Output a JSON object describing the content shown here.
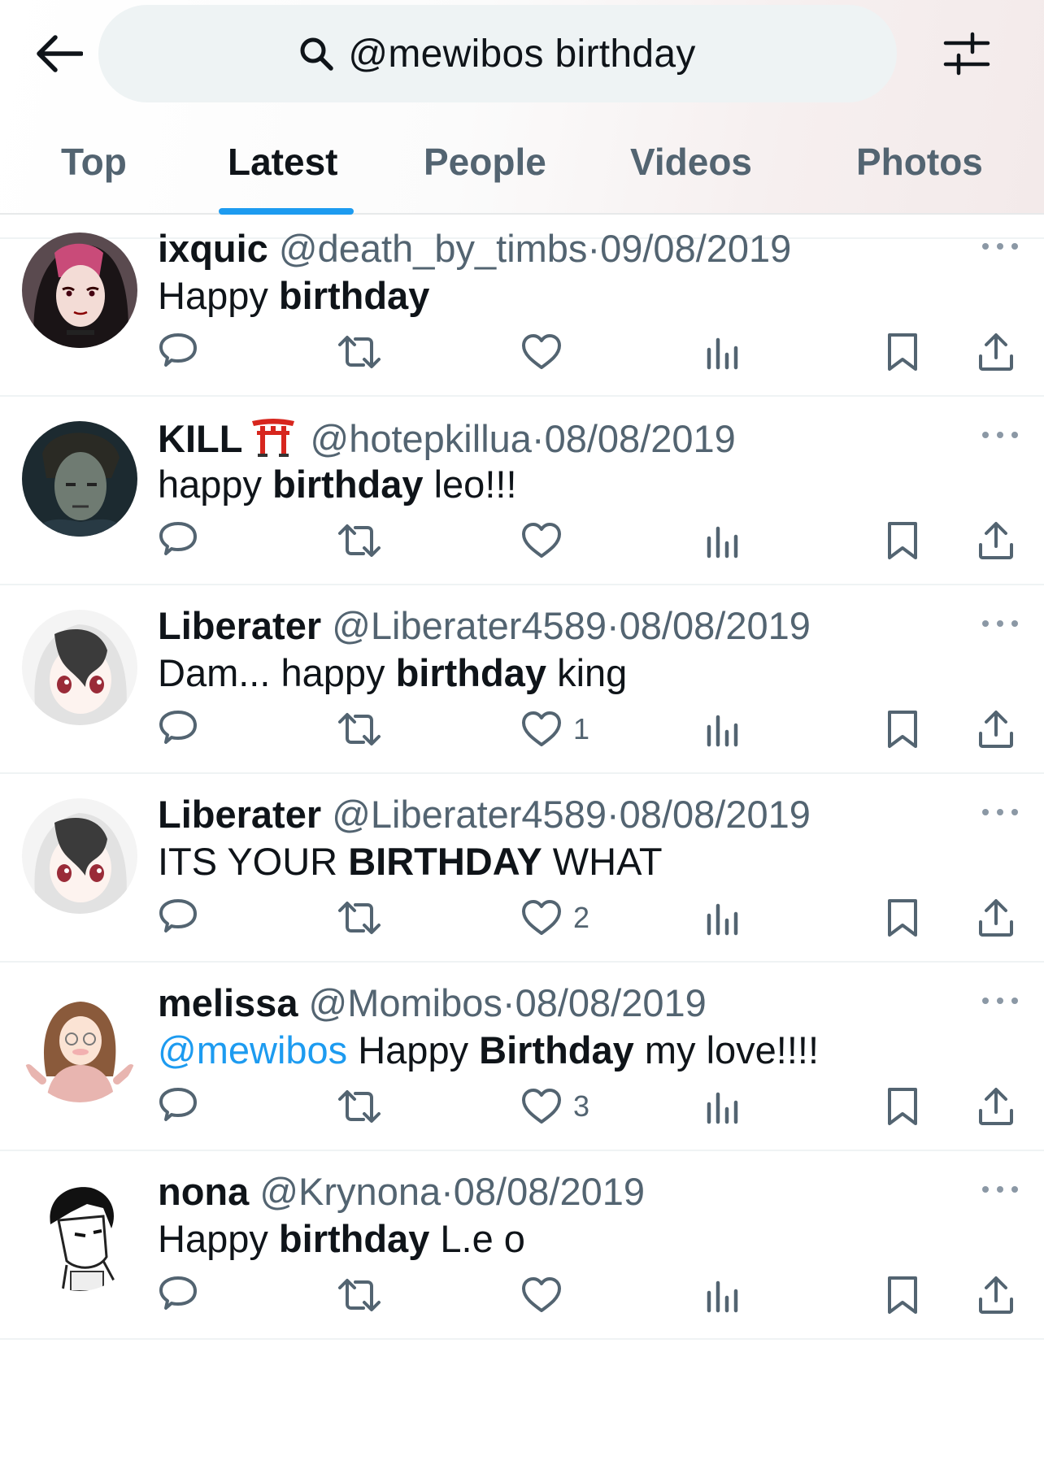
{
  "search": {
    "query": "@mewibos birthday"
  },
  "tabs": [
    {
      "label": "Top"
    },
    {
      "label": "Latest"
    },
    {
      "label": "People"
    },
    {
      "label": "Videos"
    },
    {
      "label": "Photos"
    }
  ],
  "active_tab": "Latest",
  "colors": {
    "accent": "#1d9bf0",
    "secondary_text": "#536471",
    "primary_text": "#0f1419"
  },
  "tweets": [
    {
      "name": "ixquic",
      "handle": "@death_by_timbs",
      "sep": "·",
      "date": "09/08/2019",
      "text": {
        "mention": "",
        "before": "Happy ",
        "bold": "birthday",
        "after": ""
      },
      "likes": ""
    },
    {
      "name": "KILL",
      "emoji": "torii-gate",
      "handle": "@hotepkillua",
      "sep": "·",
      "date": "08/08/2019",
      "text": {
        "mention": "",
        "before": "happy ",
        "bold": "birthday",
        "after": " leo!!!"
      },
      "likes": ""
    },
    {
      "name": "Liberater",
      "handle": "@Liberater4589",
      "sep": "·",
      "date": "08/08/2019",
      "text": {
        "mention": "",
        "before": "Dam... happy ",
        "bold": "birthday",
        "after": " king"
      },
      "likes": "1"
    },
    {
      "name": "Liberater",
      "handle": "@Liberater4589",
      "sep": "·",
      "date": "08/08/2019",
      "text": {
        "mention": "",
        "before": "ITS YOUR ",
        "bold": "BIRTHDAY",
        "after": " WHAT"
      },
      "likes": "2"
    },
    {
      "name": "melissa",
      "handle": "@Momibos",
      "sep": "·",
      "date": "08/08/2019",
      "text": {
        "mention": "@mewibos",
        "before": " Happy ",
        "bold": "Birthday",
        "after": " my love!!!!"
      },
      "likes": "3"
    },
    {
      "name": "nona",
      "handle": "@Krynona",
      "sep": "·",
      "date": "08/08/2019",
      "text": {
        "mention": "",
        "before": "Happy ",
        "bold": "birthday",
        "after": " L.e o"
      },
      "likes": ""
    }
  ]
}
